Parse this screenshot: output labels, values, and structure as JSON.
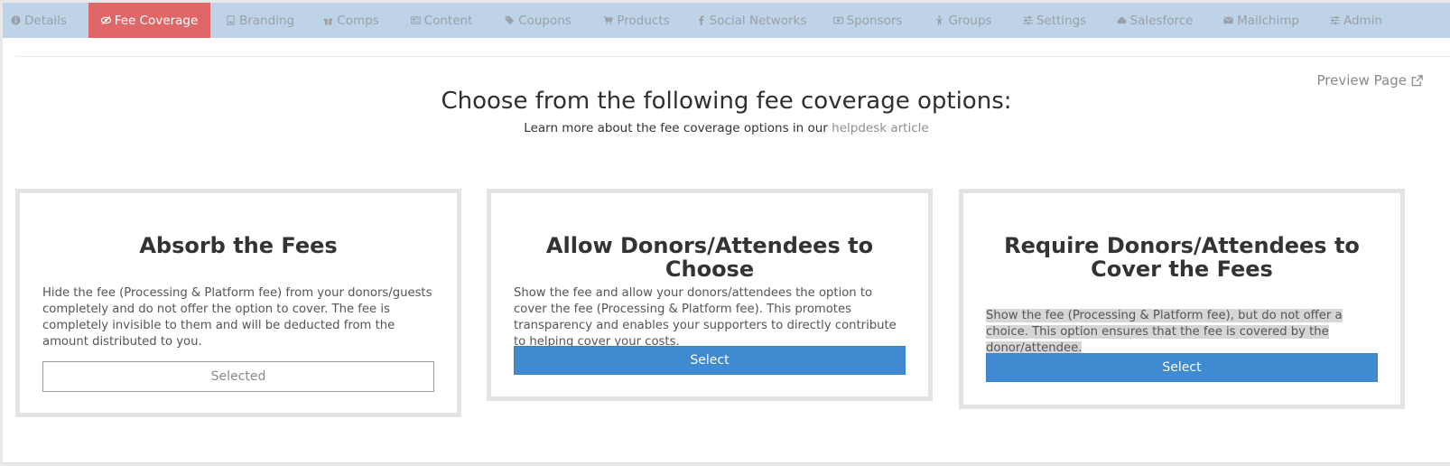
{
  "tabs": [
    {
      "label": "Details",
      "icon": "info-circle-icon",
      "active": false
    },
    {
      "label": "Fee Coverage",
      "icon": "eye-slash-icon",
      "active": true
    },
    {
      "label": "Branding",
      "icon": "image-file-icon",
      "active": false
    },
    {
      "label": "Comps",
      "icon": "gift-icon",
      "active": false
    },
    {
      "label": "Content",
      "icon": "newspaper-icon",
      "active": false
    },
    {
      "label": "Coupons",
      "icon": "tags-icon",
      "active": false
    },
    {
      "label": "Products",
      "icon": "cart-icon",
      "active": false
    },
    {
      "label": "Social Networks",
      "icon": "facebook-icon",
      "active": false
    },
    {
      "label": "Sponsors",
      "icon": "money-bill-icon",
      "active": false
    },
    {
      "label": "Groups",
      "icon": "child-icon",
      "active": false
    },
    {
      "label": "Settings",
      "icon": "sliders-icon",
      "active": false
    },
    {
      "label": "Salesforce",
      "icon": "cloud-icon",
      "active": false
    },
    {
      "label": "Mailchimp",
      "icon": "envelope-icon",
      "active": false
    },
    {
      "label": "Admin",
      "icon": "sliders-icon",
      "active": false
    }
  ],
  "preview": {
    "label": "Preview Page",
    "icon": "external-link-icon"
  },
  "main": {
    "heading": "Choose from the following fee coverage options:",
    "subhead_prefix": "Learn more about the fee coverage options in our ",
    "subhead_link": "helpdesk article"
  },
  "options": [
    {
      "title": "Absorb the Fees",
      "description": "Hide the fee (Processing & Platform fee) from your donors/guests completely and do not offer the option to cover. The fee is completely invisible to them and will be deducted from the amount distributed to you.",
      "button": "Selected"
    },
    {
      "title": "Allow Donors/Attendees to Choose",
      "description": "Show the fee and allow your donors/attendees the option to cover the fee (Processing & Platform fee). This promotes transparency and enables your supporters to directly contribute to helping cover your costs.",
      "button": "Select"
    },
    {
      "title": "Require Donors/Attendees to Cover the Fees",
      "description": "Show the fee (Processing & Platform fee), but do not offer a choice. This option ensures that the fee is covered by the donor/attendee.",
      "button": "Select"
    }
  ],
  "colors": {
    "tabbar_bg": "#bed3e8",
    "active_tab": "#e06767",
    "select_button": "#3f8ad1",
    "card_border": "#e3e3e3"
  }
}
